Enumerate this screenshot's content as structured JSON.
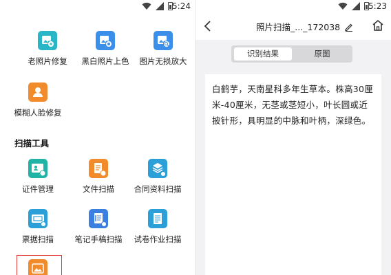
{
  "left": {
    "status": {
      "time": "5:24"
    },
    "tools_top": [
      {
        "label": "老照片修复",
        "color": "#2bb6c8",
        "icon": "photo-repair-icon"
      },
      {
        "label": "黑白照片上色",
        "color": "#3b8fe8",
        "icon": "colorize-icon"
      },
      {
        "label": "图片无损放大",
        "color": "#3b8fe8",
        "icon": "zoom-in-icon"
      },
      {
        "label": "模糊人脸修复",
        "color": "#f28b2c",
        "icon": "face-repair-icon"
      }
    ],
    "section_title": "扫描工具",
    "tools_scan": [
      {
        "label": "证件管理",
        "color": "#20b3a6",
        "icon": "id-card-icon"
      },
      {
        "label": "文件扫描",
        "color": "#f28b2c",
        "icon": "document-scan-icon"
      },
      {
        "label": "合同资料扫描",
        "color": "#2b9fd8",
        "icon": "contract-scan-icon"
      },
      {
        "label": "票据扫描",
        "color": "#2b9fd8",
        "icon": "receipt-scan-icon"
      },
      {
        "label": "笔记手稿扫描",
        "color": "#3b7fe0",
        "icon": "notes-scan-icon"
      },
      {
        "label": "试卷作业扫描",
        "color": "#2b9fd8",
        "icon": "exam-scan-icon"
      },
      {
        "label": "",
        "color": "#f28b2c",
        "icon": "image-text-icon"
      }
    ]
  },
  "right": {
    "status": {
      "time": "5:23"
    },
    "title": "照片扫描_..._172038",
    "tabs": [
      "识别结果",
      "原图"
    ],
    "ocr_text": "白鹤芋，天南星科多年生草本。株高30厘米-40厘米，无茎或茎短小，叶长圆或近披针形，具明显的中脉和叶柄，深绿色。"
  }
}
